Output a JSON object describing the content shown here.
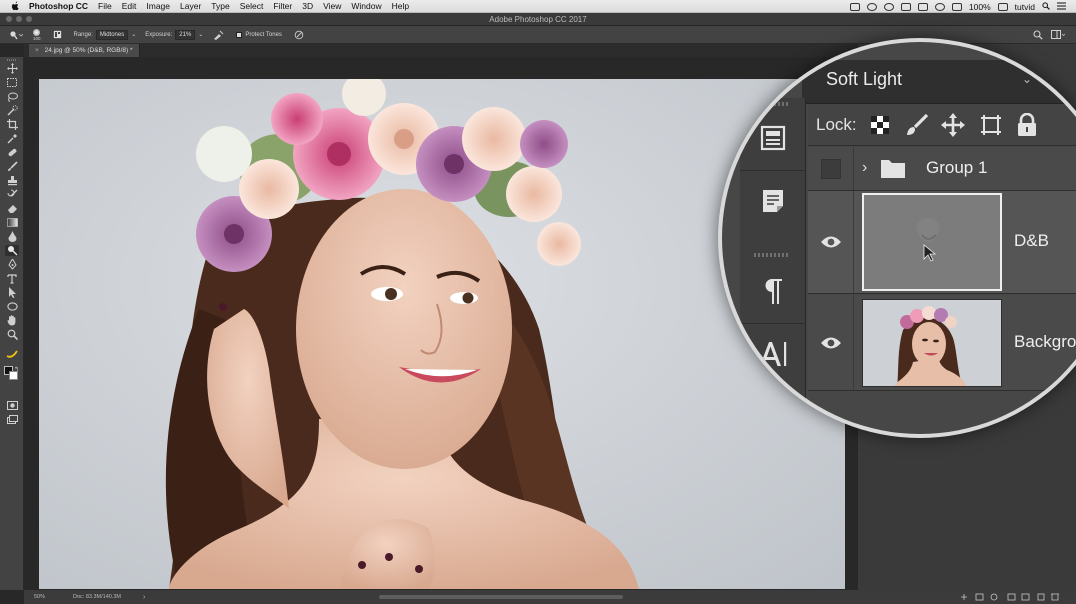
{
  "menubar": {
    "app_name": "Photoshop CC",
    "items": [
      "File",
      "Edit",
      "Image",
      "Layer",
      "Type",
      "Select",
      "Filter",
      "3D",
      "View",
      "Window",
      "Help"
    ],
    "battery": "100%",
    "user": "tutvid"
  },
  "window": {
    "title": "Adobe Photoshop CC 2017"
  },
  "options_bar": {
    "brush_size": "100",
    "range_label": "Range:",
    "range_value": "Midtones",
    "exposure_label": "Exposure:",
    "exposure_value": "21%",
    "protect_tones_label": "Protect Tones"
  },
  "document": {
    "tab_label": "24.jpg @ 50% (D&B, RGB/8) *"
  },
  "status_bar": {
    "zoom": "50%",
    "doc_size": "Doc: 83.3M/140.3M"
  },
  "layers_panel": {
    "blend_mode": "Soft Light",
    "lock_label": "Lock:",
    "layers": [
      {
        "name": "Group 1",
        "type": "group"
      },
      {
        "name": "D&B",
        "type": "layer",
        "selected": true
      },
      {
        "name": "Backgro",
        "type": "layer"
      }
    ],
    "side_icons": [
      "properties-icon",
      "notes-icon",
      "paragraph-icon",
      "character-icon"
    ]
  },
  "colors": {
    "accent": "#4a90d9",
    "panel": "#474747",
    "canvas_bg": "#282828"
  }
}
